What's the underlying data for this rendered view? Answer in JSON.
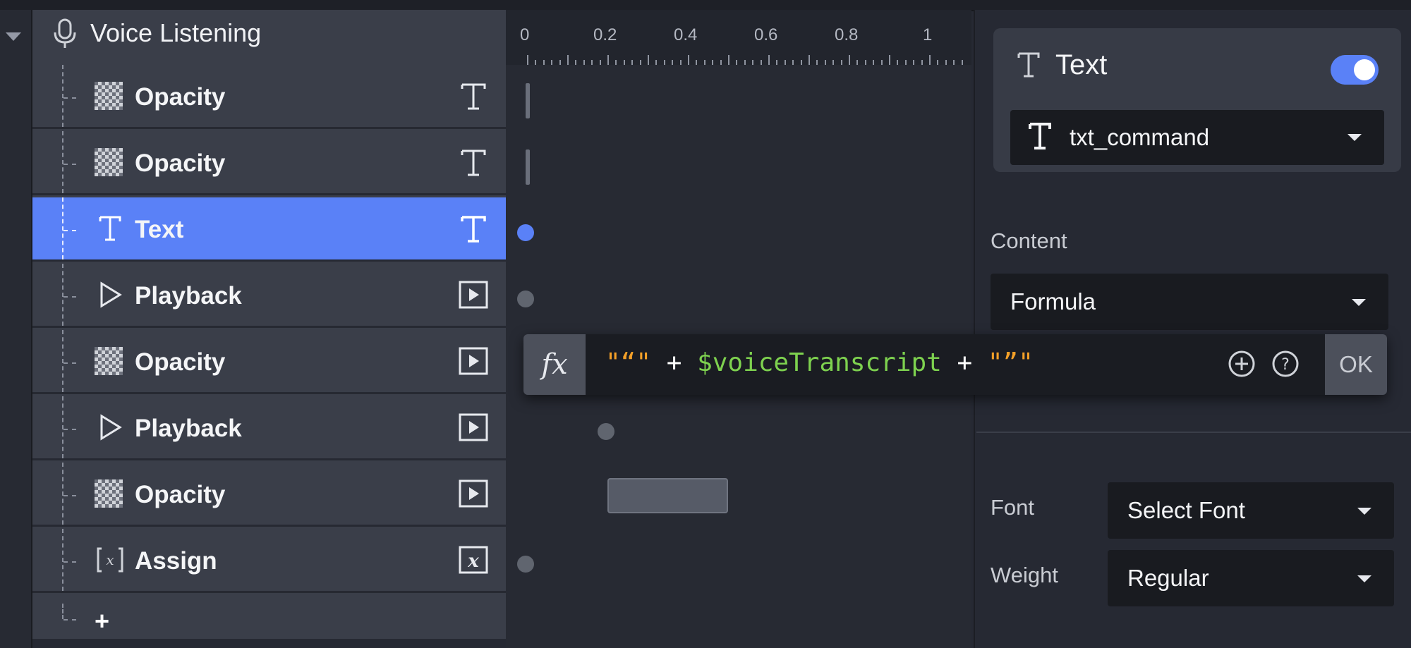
{
  "layers": {
    "header": {
      "title": "Voice Listening",
      "icon": "microphone-icon"
    },
    "rows": [
      {
        "label": "Opacity",
        "icon": "checker-icon",
        "end_icon": "text-icon"
      },
      {
        "label": "Opacity",
        "icon": "checker-icon",
        "end_icon": "text-icon"
      },
      {
        "label": "Text",
        "icon": "text-icon",
        "end_icon": "text-icon",
        "selected": true
      },
      {
        "label": "Playback",
        "icon": "play-icon",
        "end_icon": "play-box-icon"
      },
      {
        "label": "Opacity",
        "icon": "checker-icon",
        "end_icon": "play-box-icon"
      },
      {
        "label": "Playback",
        "icon": "play-icon",
        "end_icon": "play-box-icon"
      },
      {
        "label": "Opacity",
        "icon": "checker-icon",
        "end_icon": "play-box-icon"
      },
      {
        "label": "Assign",
        "icon": "variable-icon",
        "end_icon": "variable-box-icon"
      }
    ],
    "add_label": "+"
  },
  "timeline": {
    "ruler_labels": [
      "0",
      "0.2",
      "0.4",
      "0.6",
      "0.8",
      "1"
    ]
  },
  "formula": {
    "fx_label": "fx",
    "tokens": {
      "open_quote": "\"“\"",
      "plus1": " + ",
      "variable": "$voiceTranscript",
      "plus2": " + ",
      "close_quote": "\"”\""
    },
    "ok_label": "OK"
  },
  "properties": {
    "card": {
      "title": "Text",
      "enabled": true,
      "target": "txt_command"
    },
    "content": {
      "label": "Content",
      "value": "Formula"
    },
    "font": {
      "label": "Font",
      "value": "Select Font"
    },
    "weight": {
      "label": "Weight",
      "value": "Regular"
    }
  },
  "colors": {
    "accent": "#5a81f7",
    "string": "#f4a028",
    "variable": "#7ed24f"
  }
}
